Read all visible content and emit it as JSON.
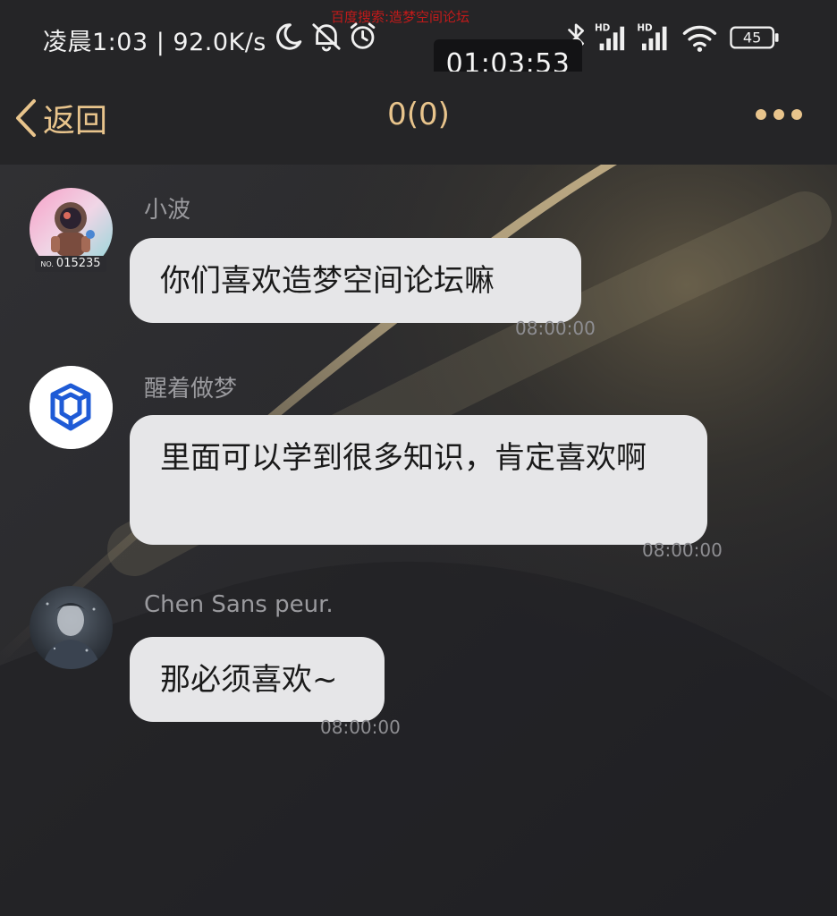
{
  "status_bar": {
    "time_text": "凌晨1:03 | 92.0K/s",
    "watermark": "百度搜索:造梦空间论坛",
    "battery": "45",
    "network_hd_1": "HD",
    "network_hd_2": "HD",
    "timer": "01:03:53"
  },
  "nav": {
    "back_label": "返回",
    "title": "0(0)"
  },
  "messages": [
    {
      "sender": "小波",
      "text": "你们喜欢造梦空间论坛嘛",
      "time": "08:00:00",
      "badge_prefix": "NO.",
      "badge_number": "015235"
    },
    {
      "sender": "醒着做梦",
      "text": "里面可以学到很多知识，肯定喜欢啊",
      "time": "08:00:00"
    },
    {
      "sender": "Chen Sans peur.",
      "text": "那必须喜欢~",
      "time": "08:00:00"
    }
  ],
  "colors": {
    "accent": "#e8c48c",
    "background": "#27272a",
    "bubble": "#e6e6e8"
  }
}
